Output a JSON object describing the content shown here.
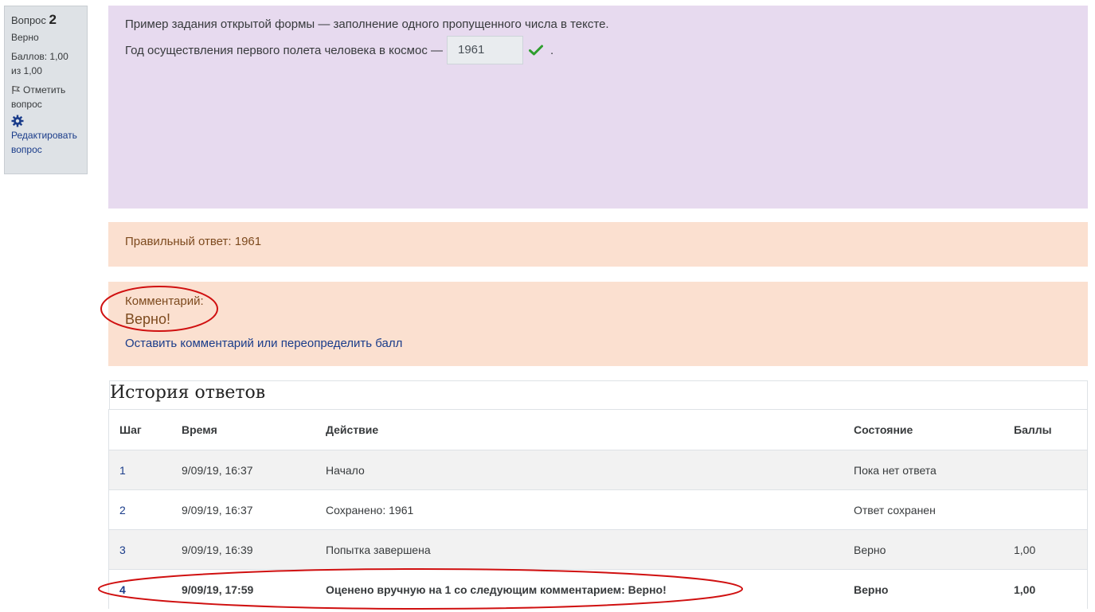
{
  "info": {
    "question_label": "Вопрос",
    "question_number": "2",
    "state": "Верно",
    "grade": "Баллов: 1,00 из 1,00",
    "flag_label": "Отметить вопрос",
    "edit_label": "Редактировать вопрос"
  },
  "formulation": {
    "question_text": "Пример задания открытой формы — заполнение одного пропущенного числа в тексте.",
    "prompt": "Год осуществления первого полета человека в космос —",
    "answer_value": "1961",
    "trailing": "."
  },
  "right_answer": "Правильный ответ: 1961",
  "comment": {
    "label": "Комментарий:",
    "text": "Верно!",
    "link": "Оставить комментарий или переопределить балл"
  },
  "history": {
    "title": "История ответов",
    "columns": [
      "Шаг",
      "Время",
      "Действие",
      "Состояние",
      "Баллы"
    ],
    "rows": [
      {
        "step": "1",
        "time": "9/09/19, 16:37",
        "action": "Начало",
        "state": "Пока нет ответа",
        "mark": ""
      },
      {
        "step": "2",
        "time": "9/09/19, 16:37",
        "action": "Сохранено: 1961",
        "state": "Ответ сохранен",
        "mark": ""
      },
      {
        "step": "3",
        "time": "9/09/19, 16:39",
        "action": "Попытка завершена",
        "state": "Верно",
        "mark": "1,00"
      },
      {
        "step": "4",
        "time": "9/09/19, 17:59",
        "action": "Оценено вручную на 1 со следующим комментарием: Верно!",
        "state": "Верно",
        "mark": "1,00"
      }
    ]
  },
  "colors": {
    "formulation_bg": "#e7daef",
    "feedback_bg": "#fbe0d0",
    "link": "#1a3c8a",
    "correct_check": "#2e9e2e",
    "annotation": "#d01010"
  }
}
